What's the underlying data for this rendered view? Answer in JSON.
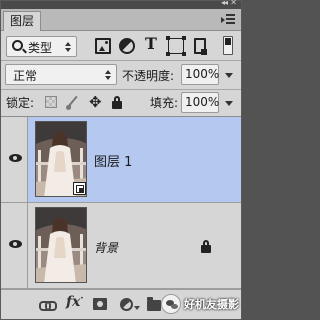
{
  "panel": {
    "tab_label": "图层"
  },
  "filter": {
    "kind_label": "类型",
    "type_icon_label": "T"
  },
  "blend": {
    "mode": "正常",
    "opacity_label": "不透明度:",
    "opacity_value": "100%"
  },
  "lock": {
    "label": "锁定:",
    "fill_label": "填充:",
    "fill_value": "100%",
    "move_glyph": "✥"
  },
  "layers": [
    {
      "name": "图层 1",
      "selected": true,
      "visible": true,
      "smart_object": true
    },
    {
      "name": "背景",
      "selected": false,
      "visible": true,
      "locked": true
    }
  ],
  "footer": {
    "fx_label": "fx"
  },
  "watermark": {
    "text": "好机友摄影"
  },
  "colors": {
    "panel_bg": "#d6d6d6",
    "selected_row": "#b5c9f0",
    "tab_bar": "#b9b9b9",
    "top_strip": "#4a4a4a"
  }
}
